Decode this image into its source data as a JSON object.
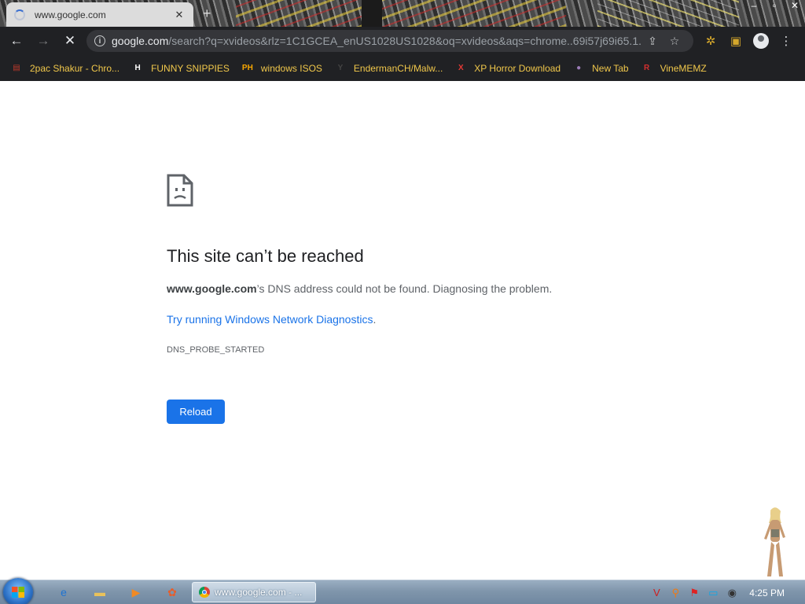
{
  "tab": {
    "title": "www.google.com",
    "close": "✕",
    "new_tab": "+"
  },
  "window_controls": {
    "minimize": "–",
    "maximize": "▫",
    "close": "✕"
  },
  "toolbar": {
    "back": "←",
    "forward": "→",
    "stop": "✕",
    "url_host": "google.com",
    "url_rest": "/search?q=xvideos&rlz=1C1GCEA_enUS1028US1028&oq=xvideos&aqs=chrome..69i57j69i65.1...",
    "info": "i",
    "share_icon": "⇪",
    "star_icon": "☆",
    "extensions_icon": "✲",
    "sidebar_icon": "▣",
    "menu_icon": "⋮"
  },
  "bookmarks": [
    {
      "label": "2pac Shakur - Chro...",
      "icon": "▤",
      "icon_color": "#c0392b"
    },
    {
      "label": "FUNNY SNIPPIES",
      "icon": "H",
      "icon_color": "#ffffff"
    },
    {
      "label": "windows ISOS",
      "icon": "PH",
      "icon_color": "#f7a600"
    },
    {
      "label": "EndermanCH/Malw...",
      "icon": "Y",
      "icon_color": "#444444"
    },
    {
      "label": "XP Horror Download",
      "icon": "X",
      "icon_color": "#e53935"
    },
    {
      "label": "New Tab",
      "icon": "●",
      "icon_color": "#9b7bb7"
    },
    {
      "label": "VineMEMZ",
      "icon": "R",
      "icon_color": "#d32f2f"
    }
  ],
  "error": {
    "title": "This site can’t be reached",
    "host": "www.google.com",
    "desc_rest": "’s DNS address could not be found. Diagnosing the problem.",
    "link": "Try running Windows Network Diagnostics",
    "link_suffix": ".",
    "code": "DNS_PROBE_STARTED",
    "reload": "Reload"
  },
  "taskbar": {
    "task_label": "www.google.com - ...",
    "clock": "4:25 PM",
    "pins": [
      {
        "name": "ie-icon",
        "glyph": "e",
        "color": "#1e73d2"
      },
      {
        "name": "explorer-icon",
        "glyph": "▬",
        "color": "#e9c25b"
      },
      {
        "name": "media-player-icon",
        "glyph": "▶",
        "color": "#f08a24"
      },
      {
        "name": "paint-icon",
        "glyph": "✿",
        "color": "#e85d2a"
      }
    ],
    "tray": [
      {
        "name": "v-tray-icon",
        "glyph": "V",
        "color": "#d01c1c"
      },
      {
        "name": "search-tray-icon",
        "glyph": "⚲",
        "color": "#f07a12"
      },
      {
        "name": "flag-tray-icon",
        "glyph": "⚑",
        "color": "#e02222"
      },
      {
        "name": "monitor-tray-icon",
        "glyph": "▭",
        "color": "#0aa7e8"
      },
      {
        "name": "volume-tray-icon",
        "glyph": "◉",
        "color": "#333333"
      }
    ]
  }
}
